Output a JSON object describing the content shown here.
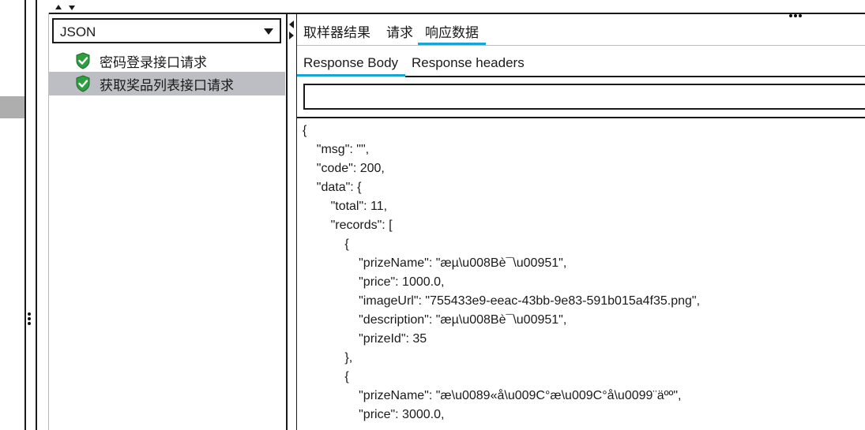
{
  "colors": {
    "accent": "#1aa3d6",
    "selection": "#bdbdc4",
    "shield_green": "#2f9e3f"
  },
  "view_selector": {
    "value": "JSON"
  },
  "results_tree": [
    {
      "label": "密码登录接口请求",
      "status_icon": "shield-check-icon",
      "selected": false
    },
    {
      "label": "获取奖品列表接口请求",
      "status_icon": "shield-check-icon",
      "selected": true
    }
  ],
  "main_tabs": [
    {
      "label": "取样器结果",
      "active": false
    },
    {
      "label": "请求",
      "active": false
    },
    {
      "label": "响应数据",
      "active": true
    }
  ],
  "sub_tabs": [
    {
      "label": "Response Body",
      "active": true
    },
    {
      "label": "Response headers",
      "active": false
    }
  ],
  "search": {
    "value": ""
  },
  "response_body": {
    "lines": [
      "{",
      "    \"msg\": \"\",",
      "    \"code\": 200,",
      "    \"data\": {",
      "        \"total\": 11,",
      "        \"records\": [",
      "            {",
      "                \"prizeName\": \"æµ\\u008Bè¯\\u00951\",",
      "                \"price\": 1000.0,",
      "                \"imageUrl\": \"755433e9-eeac-43bb-9e83-591b015a4f35.png\",",
      "                \"description\": \"æµ\\u008Bè¯\\u00951\",",
      "                \"prizeId\": 35",
      "            },",
      "            {",
      "                \"prizeName\": \"æ\\u0089«å\\u009C°æ\\u009C°å\\u0099¨äºº\",",
      "                \"price\": 3000.0,"
    ]
  }
}
